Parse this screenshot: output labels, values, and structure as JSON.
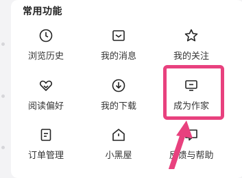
{
  "section": {
    "title": "常用功能"
  },
  "features": [
    {
      "label": "浏览历史",
      "icon": "clock-icon"
    },
    {
      "label": "我的消息",
      "icon": "message-icon"
    },
    {
      "label": "我的关注",
      "icon": "star-icon"
    },
    {
      "label": "阅读偏好",
      "icon": "heart-icon"
    },
    {
      "label": "我的下载",
      "icon": "download-icon"
    },
    {
      "label": "成为作家",
      "icon": "monitor-icon"
    },
    {
      "label": "订单管理",
      "icon": "document-icon"
    },
    {
      "label": "小黑屋",
      "icon": "house-icon"
    },
    {
      "label": "反馈与帮助",
      "icon": "help-icon"
    }
  ],
  "colors": {
    "highlight": "#e8417e",
    "icon_stroke": "#222222",
    "card_bg": "#ffffff",
    "page_bg": "#f3f3f5"
  }
}
